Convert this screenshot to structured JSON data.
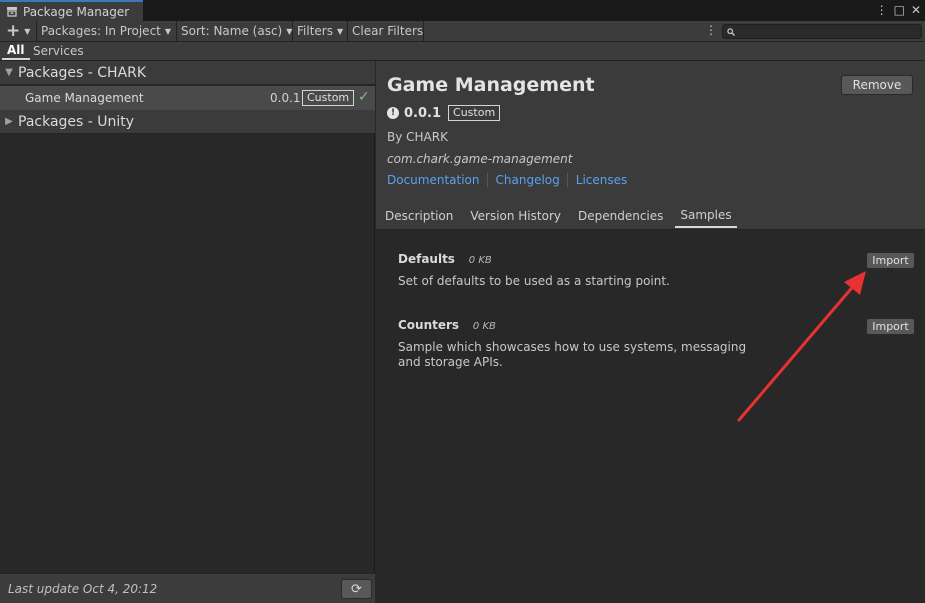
{
  "window": {
    "tab_title": "Package Manager",
    "menu_glyph": "⋮",
    "maximize_glyph": "□",
    "close_glyph": "✕"
  },
  "toolbar": {
    "add_glyph": "+",
    "packages_label": "Packages: In Project",
    "sort_label": "Sort: Name (asc)",
    "filters_label": "Filters",
    "clear_filters_label": "Clear Filters",
    "menu_glyph": "⋮",
    "search_value": "",
    "search_placeholder": ""
  },
  "filter_tabs": {
    "all": "All",
    "services": "Services"
  },
  "left": {
    "groups": [
      {
        "label": "Packages - CHARK",
        "expanded": true
      },
      {
        "label": "Packages - Unity",
        "expanded": false
      }
    ],
    "packages": [
      {
        "name": "Game Management",
        "version": "0.0.1",
        "tag": "Custom",
        "status_glyph": "✓"
      }
    ],
    "status": "Last update Oct 4, 20:12",
    "refresh_glyph": "⟳"
  },
  "detail": {
    "title": "Game Management",
    "remove_label": "Remove",
    "info_glyph": "!",
    "version": "0.0.1",
    "tag": "Custom",
    "author": "By CHARK",
    "package_id": "com.chark.game-management",
    "links": [
      "Documentation",
      "Changelog",
      "Licenses"
    ],
    "tabs": [
      "Description",
      "Version History",
      "Dependencies",
      "Samples"
    ],
    "active_tab": "Samples",
    "samples": [
      {
        "title": "Defaults",
        "size": "0 KB",
        "description": "Set of defaults to be used as a starting point.",
        "import_label": "Import"
      },
      {
        "title": "Counters",
        "size": "0 KB",
        "description": "Sample which showcases how to use systems, messaging and storage APIs.",
        "import_label": "Import"
      }
    ]
  },
  "colors": {
    "accent_link": "#5aa1f0",
    "arrow": "#e83232",
    "installed_check": "#7ec17e"
  }
}
